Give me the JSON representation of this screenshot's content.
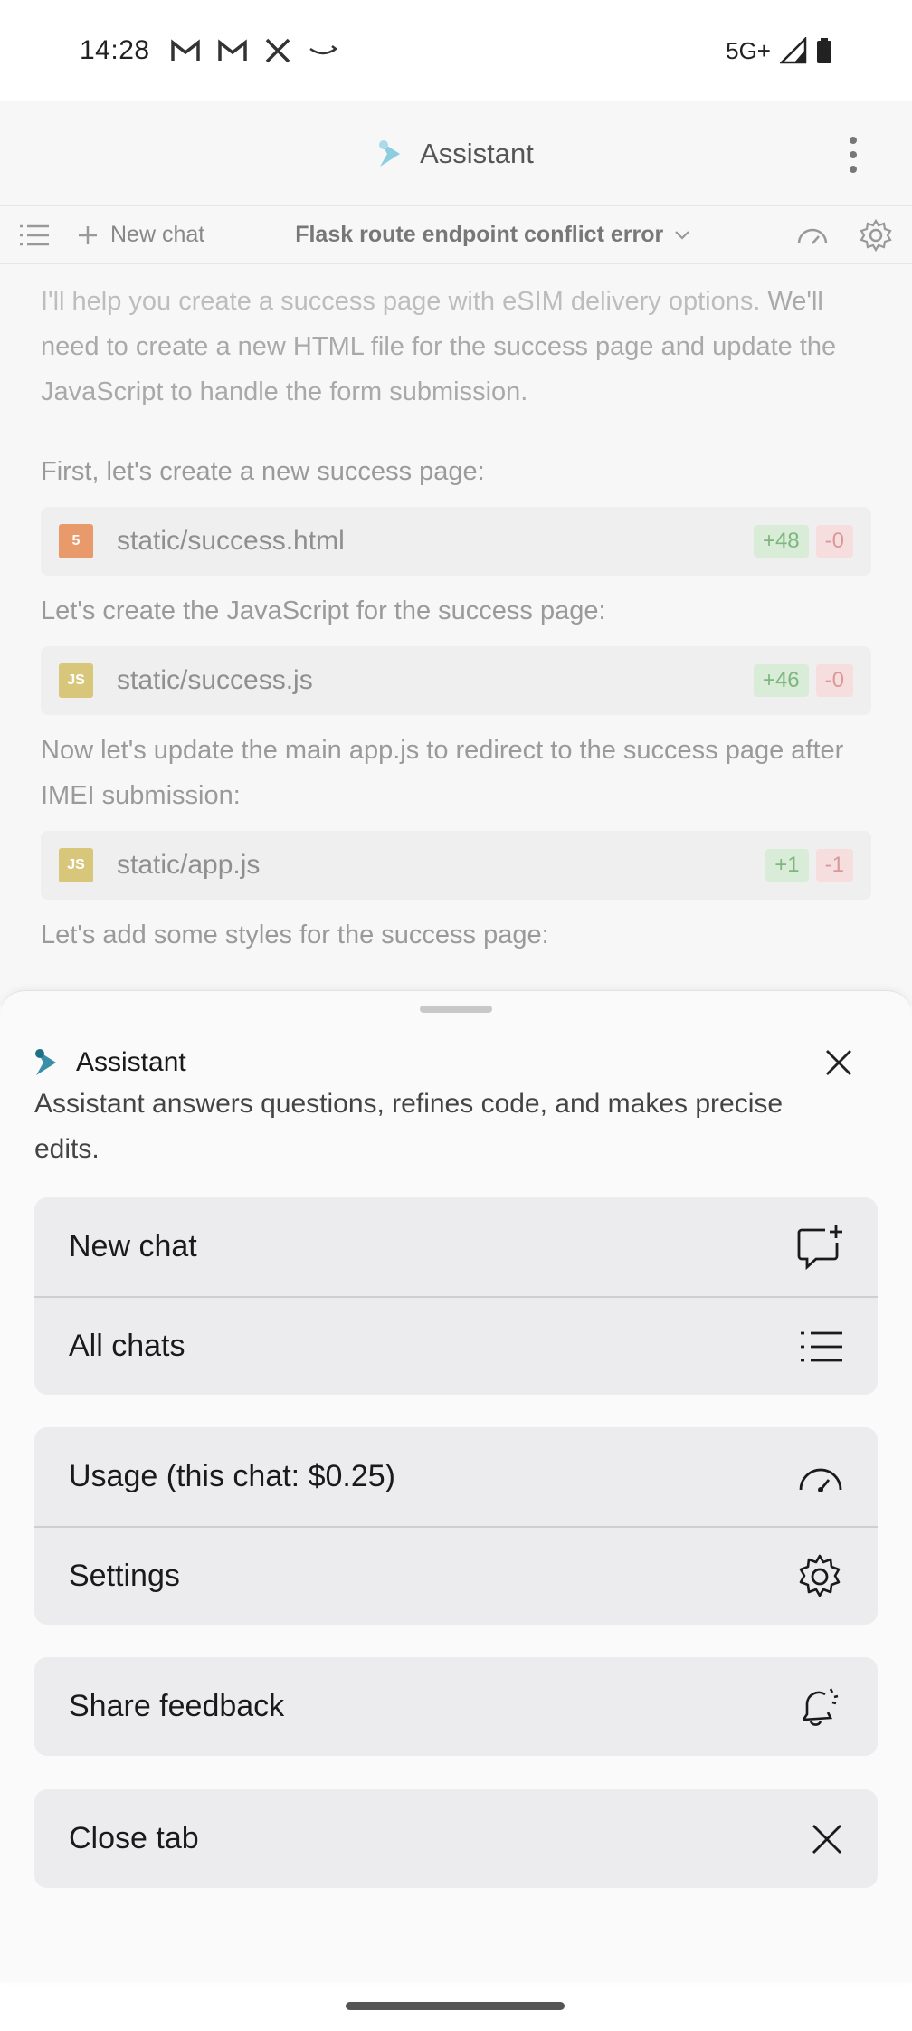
{
  "status_bar": {
    "time": "14:28",
    "network": "5G+",
    "icons": [
      "gmail-icon",
      "gmail-icon",
      "x-icon",
      "amazon-icon",
      "signal-icon",
      "battery-icon"
    ]
  },
  "app": {
    "title": "Assistant",
    "toolbar": {
      "new_chat": "New chat",
      "chat_title": "Flask route endpoint conflict error"
    },
    "messages": {
      "intro_first": "I'll help you create a success page with eSIM delivery options.",
      "intro_rest": "We'll need to create a new HTML file for the success page and update the JavaScript to handle the form submission.",
      "step1": "First, let's create a new success page:",
      "step2": "Let's create the JavaScript for the success page:",
      "step3": "Now let's update the main app.js to redirect to the success page after IMEI submission:",
      "step4": "Let's add some styles for the success page:"
    },
    "files": [
      {
        "name": "static/success.html",
        "icon_text": "5",
        "add": "+48",
        "del": "-0"
      },
      {
        "name": "static/success.js",
        "icon_text": "JS",
        "add": "+46",
        "del": "-0"
      },
      {
        "name": "static/app.js",
        "icon_text": "JS",
        "add": "+1",
        "del": "-1"
      }
    ]
  },
  "sheet": {
    "title": "Assistant",
    "description": "Assistant answers questions, refines code, and makes precise edits.",
    "items": {
      "new_chat": "New chat",
      "all_chats": "All chats",
      "usage": "Usage (this chat: $0.25)",
      "settings": "Settings",
      "share_feedback": "Share feedback",
      "close_tab": "Close tab"
    }
  },
  "colors": {
    "accent": "#3a8fa8",
    "html_icon": "#e89a6a",
    "js_icon": "#d8c77a"
  }
}
